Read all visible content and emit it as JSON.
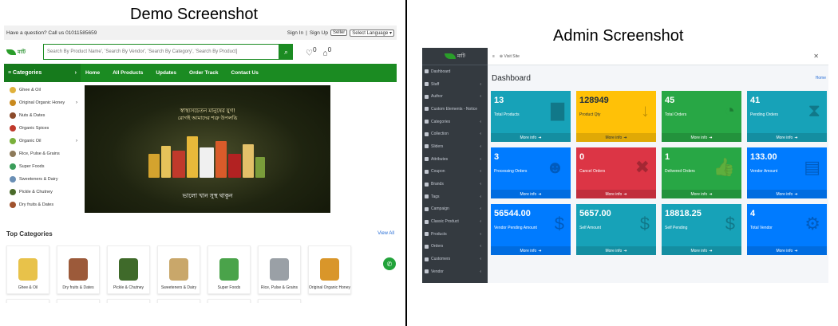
{
  "captions": {
    "left": "Demo Screenshot",
    "right": "Admin Screenshot"
  },
  "demo": {
    "topbar": {
      "question": "Have a question? Call us 01011585659",
      "sign_in": "Sign In",
      "sign_up": "Sign Up",
      "seller": "Seller",
      "language": "Select Language ▾"
    },
    "search_placeholder": "Search By Product Name', 'Search By Vendor', 'Search By Category', 'Search By Product]",
    "wishlist_count": "0",
    "cart_count": "0",
    "categories_label": "Categories",
    "nav_links": [
      "Home",
      "All Products",
      "Updates",
      "Order Track",
      "Contact Us"
    ],
    "categories": [
      {
        "label": "Ghee & Oil",
        "color": "#e0b13b",
        "arrow": false
      },
      {
        "label": "Original Organic Honey",
        "color": "#c98a1e",
        "arrow": true
      },
      {
        "label": "Nuts & Dates",
        "color": "#8b4a2a",
        "arrow": false
      },
      {
        "label": "Organic Spices",
        "color": "#c0392b",
        "arrow": false
      },
      {
        "label": "Organic Oil",
        "color": "#7ab03b",
        "arrow": true
      },
      {
        "label": "Rice, Pulse & Grains",
        "color": "#8d7a5a",
        "arrow": false
      },
      {
        "label": "Super Foods",
        "color": "#3a9d5a",
        "arrow": false
      },
      {
        "label": "Sweeteners & Dairy",
        "color": "#6a8fb5",
        "arrow": false
      },
      {
        "label": "Pickle & Chutney",
        "color": "#4a6b2a",
        "arrow": false
      },
      {
        "label": "Dry fruits & Dates",
        "color": "#a0522d",
        "arrow": false
      }
    ],
    "banner": {
      "line1": "স্বাস্থ্যসচেতন মানুষের যুগ!",
      "line2": "রোগই আমাদের শত্রু উপলব্ধি",
      "line3": "ভালো খান সুস্থ থাকুন"
    },
    "top_categories_title": "Top Categories",
    "view_all": "View All",
    "top_categories": [
      {
        "label": "Ghee & Oil",
        "color": "#e8c24a"
      },
      {
        "label": "Dry fruits & Dates",
        "color": "#9c5a3a"
      },
      {
        "label": "Pickle & Chutney",
        "color": "#3f6a2a"
      },
      {
        "label": "Sweeteners & Dairy",
        "color": "#c9a76a"
      },
      {
        "label": "Super Foods",
        "color": "#4aa34a"
      },
      {
        "label": "Rice, Pulse & Grains",
        "color": "#9aa0a6"
      },
      {
        "label": "Original Organic Honey",
        "color": "#d9962a"
      }
    ],
    "extra_cards": 6
  },
  "admin": {
    "visit_site": "Visit Site",
    "page_title": "Dashboard",
    "breadcrumb": "Home",
    "sidebar": [
      "Dashboard",
      "Staff",
      "Author",
      "Custom Elements - Notice",
      "Categories",
      "Collection",
      "Sliders",
      "Attributes",
      "Coupon",
      "Brands",
      "Tags",
      "Campaign",
      "Classic Product",
      "Products",
      "Orders",
      "Customers",
      "Vendor"
    ],
    "sidebar_arrows": [
      false,
      true,
      true,
      false,
      true,
      true,
      true,
      true,
      true,
      true,
      true,
      true,
      true,
      true,
      true,
      true,
      true
    ],
    "boxes": [
      {
        "value": "13",
        "label": "Total Products",
        "color": "#17a2b8",
        "icon": "bed-icon",
        "glyph": "▇",
        "dark": false
      },
      {
        "value": "128949",
        "label": "Product Qty",
        "color": "#ffc107",
        "icon": "sort-numeric-icon",
        "glyph": "↓",
        "dark": true
      },
      {
        "value": "45",
        "label": "Total Orders",
        "color": "#28a745",
        "icon": "pie-icon",
        "glyph": "◔",
        "dark": false
      },
      {
        "value": "41",
        "label": "Pending Orders",
        "color": "#17a2b8",
        "icon": "hourglass-icon",
        "glyph": "⧗",
        "dark": false
      },
      {
        "value": "3",
        "label": "Processing Orders",
        "color": "#007bff",
        "icon": "people-icon",
        "glyph": "☻",
        "dark": false
      },
      {
        "value": "0",
        "label": "Cancel Orders",
        "color": "#dc3545",
        "icon": "close-box-icon",
        "glyph": "✖",
        "dark": false
      },
      {
        "value": "1",
        "label": "Delivered Orders",
        "color": "#28a745",
        "icon": "thumbs-up-icon",
        "glyph": "👍",
        "dark": false
      },
      {
        "value": "133.00",
        "label": "Vendor Amount",
        "color": "#007bff",
        "icon": "id-card-icon",
        "glyph": "▤",
        "dark": false
      },
      {
        "value": "56544.00",
        "label": "Vendor Pending Amount",
        "color": "#007bff",
        "icon": "money-icon",
        "glyph": "$",
        "dark": false
      },
      {
        "value": "5657.00",
        "label": "Self Amount",
        "color": "#17a2b8",
        "icon": "money-icon",
        "glyph": "$",
        "dark": false
      },
      {
        "value": "18818.25",
        "label": "Self Pending",
        "color": "#17a2b8",
        "icon": "money-icon",
        "glyph": "$",
        "dark": false
      },
      {
        "value": "4",
        "label": "Total Vendor",
        "color": "#007bff",
        "icon": "users-icon",
        "glyph": "⚙",
        "dark": false
      }
    ],
    "more_info": "More info"
  }
}
